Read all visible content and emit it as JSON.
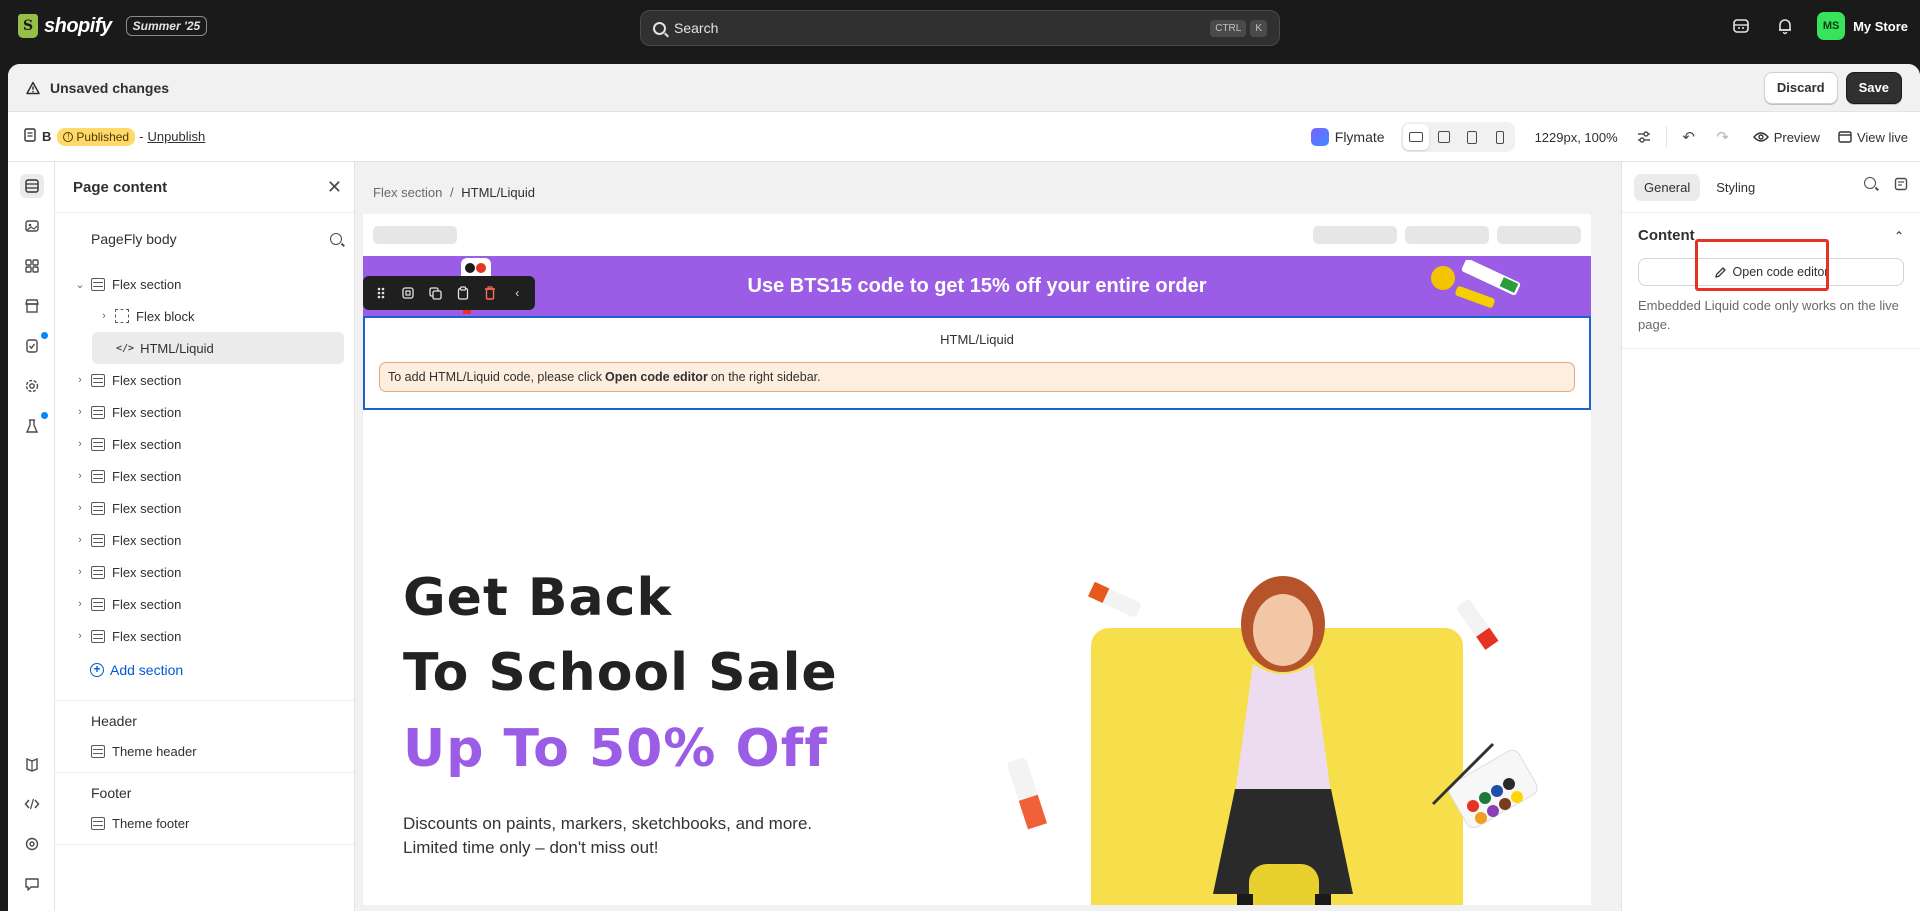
{
  "topbar": {
    "brand": "shopify",
    "edition_badge": "Summer '25",
    "search_label": "Search",
    "shortcut_keys": [
      "CTRL",
      "K"
    ],
    "store_initials": "MS",
    "store_name": "My Store",
    "store_avatar_color": "#36e35a"
  },
  "unsaved": {
    "message": "Unsaved changes",
    "discard_label": "Discard",
    "save_label": "Save"
  },
  "toolbar": {
    "page_name": "B",
    "status_badge": "Published",
    "separator": "-",
    "unpublish_label": "Unpublish",
    "app_name": "Flymate",
    "viewport_text": "1229px, 100%",
    "preview_label": "Preview",
    "view_live_label": "View live"
  },
  "left_panel": {
    "title": "Page content",
    "body_label": "PageFly body",
    "expanded_section": "Flex section",
    "children": [
      "Flex block",
      "HTML/Liquid"
    ],
    "sections": [
      "Flex section",
      "Flex section",
      "Flex section",
      "Flex section",
      "Flex section",
      "Flex section",
      "Flex section",
      "Flex section",
      "Flex section"
    ],
    "add_section_label": "Add section",
    "header_group": "Header",
    "header_item": "Theme header",
    "footer_group": "Footer",
    "footer_item": "Theme footer"
  },
  "canvas": {
    "breadcrumb_parent": "Flex section",
    "breadcrumb_sep": "/",
    "breadcrumb_current": "HTML/Liquid",
    "promo_text": "Use BTS15 code to get 15% off your entire order",
    "promo_color": "#9b5de5",
    "html_block_title": "HTML/Liquid",
    "html_note_pre": "To add HTML/Liquid code, please click",
    "html_note_bold": "Open code editor",
    "html_note_post": "on the right sidebar.",
    "hero_line1": "Get Back",
    "hero_line2": "To School Sale",
    "hero_line3": "Up To 50% Off",
    "hero_desc1": "Discounts on paints, markers, sketchbooks, and more.",
    "hero_desc2": "Limited time only – don't miss out!",
    "accent_yellow": "#f7df4c",
    "selection_color": "#1f5fd1"
  },
  "right_panel": {
    "tab_general": "General",
    "tab_styling": "Styling",
    "section_title": "Content",
    "open_code_label": "Open code editor",
    "help_text": "Embedded Liquid code only works on the live page."
  }
}
